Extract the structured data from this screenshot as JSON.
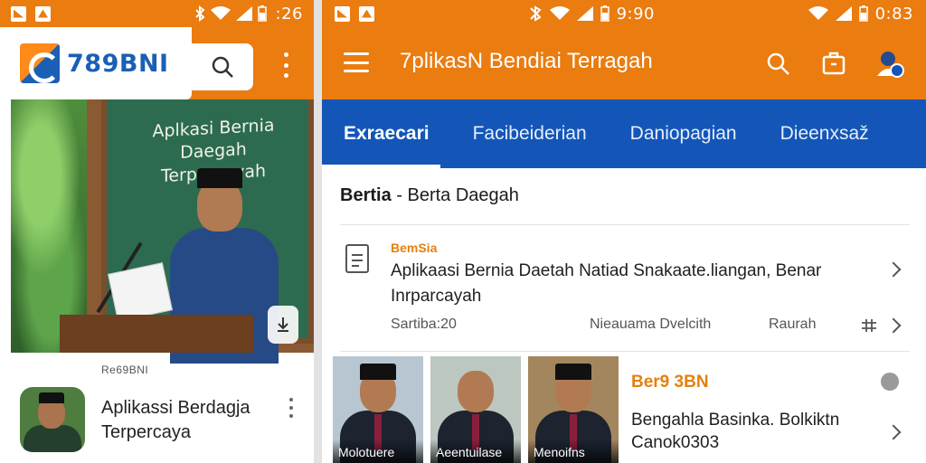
{
  "colors": {
    "brand_orange": "#ea7c10",
    "brand_blue": "#1456b8",
    "accent_text": "#e3800f"
  },
  "left_screen": {
    "status": {
      "time": ":26"
    },
    "app": {
      "brand_name": "789BNI"
    },
    "hero": {
      "board_text_line1": "Aplkasi Bernia Daegah",
      "board_text_line2": "Terpercayah"
    },
    "feed_item": {
      "source": "Re69BNI",
      "title_line1": "Aplikassi Berdagja",
      "title_line2": "Terpercaya"
    }
  },
  "right_screen": {
    "status": {
      "time_left": "9:90",
      "time_right": "0:83"
    },
    "header": {
      "title": "7plikasN Bendiai Terragah"
    },
    "tabs": [
      {
        "label": "Exraecari"
      },
      {
        "label": "Facibeiderian"
      },
      {
        "label": "Daniopagian"
      },
      {
        "label": "Dieenxsaž"
      }
    ],
    "section": {
      "title_bold": "Bertia",
      "title_rest": " - Berta Daegah"
    },
    "article": {
      "category": "BemSia",
      "title": "Aplikaasi Bernia Daetah  Natiad Snakaate.liangan, Benar Inrparcayah",
      "meta_date": "Sartiba:20",
      "meta_author": "Nieauama Dvelcith",
      "meta_tag": "Raurah"
    },
    "thumbnails": [
      {
        "caption": "Molotuere"
      },
      {
        "caption": "Aeentuilase"
      },
      {
        "caption": "Menoifns"
      }
    ],
    "related": {
      "category": "Ber9 3BN",
      "title": "Bengahla Basinka. Bolkiktn Canok0303"
    }
  }
}
